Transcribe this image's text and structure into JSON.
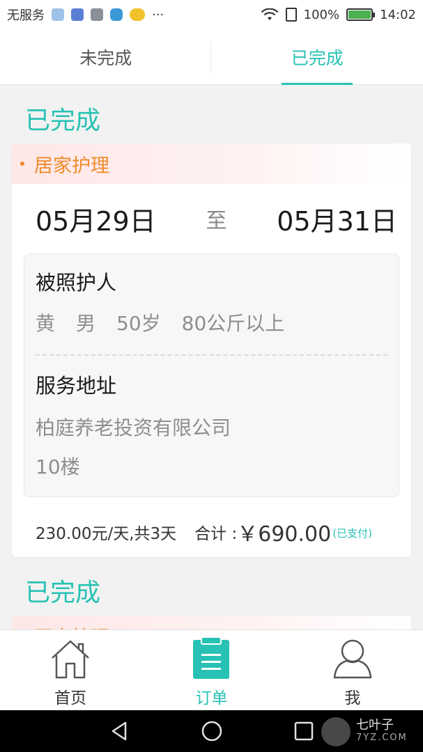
{
  "status_bar": {
    "carrier": "无服务",
    "battery_percent": "100%",
    "time": "14:02",
    "more": "···",
    "icons": [
      "usb-icon",
      "calendar-icon",
      "gallery-icon",
      "shield-icon",
      "message-icon",
      "wifi-icon",
      "sim-icon",
      "battery-icon"
    ]
  },
  "tabs": [
    {
      "label": "未完成",
      "active": false
    },
    {
      "label": "已完成",
      "active": true
    }
  ],
  "orders": [
    {
      "status": "已完成",
      "service": "居家护理",
      "start_date": "05月29日",
      "date_separator": "至",
      "end_date": "05月31日",
      "care_recipient_label": "被照护人",
      "care_recipient": {
        "name": "黄",
        "gender": "男",
        "age": "50岁",
        "weight": "80公斤以上"
      },
      "address_label": "服务地址",
      "address_line1": "柏庭养老投资有限公司",
      "address_line2": "10楼",
      "rate": "230.00元/天,共3天",
      "total_label": "合计 :",
      "total_amount": "￥690.00",
      "payment_status": "(已支付)"
    },
    {
      "status": "已完成",
      "service": "居家护理"
    }
  ],
  "bottom_nav": [
    {
      "label": "首页",
      "icon": "home-icon",
      "active": false
    },
    {
      "label": "订单",
      "icon": "clipboard-icon",
      "active": true
    },
    {
      "label": "我",
      "icon": "person-icon",
      "active": false
    }
  ],
  "watermark": {
    "name": "七叶子",
    "site": "7YZ.COM"
  },
  "colors": {
    "accent": "#27c2b4",
    "service_tag": "#f08a2b",
    "muted_text": "#8e8e8e"
  }
}
